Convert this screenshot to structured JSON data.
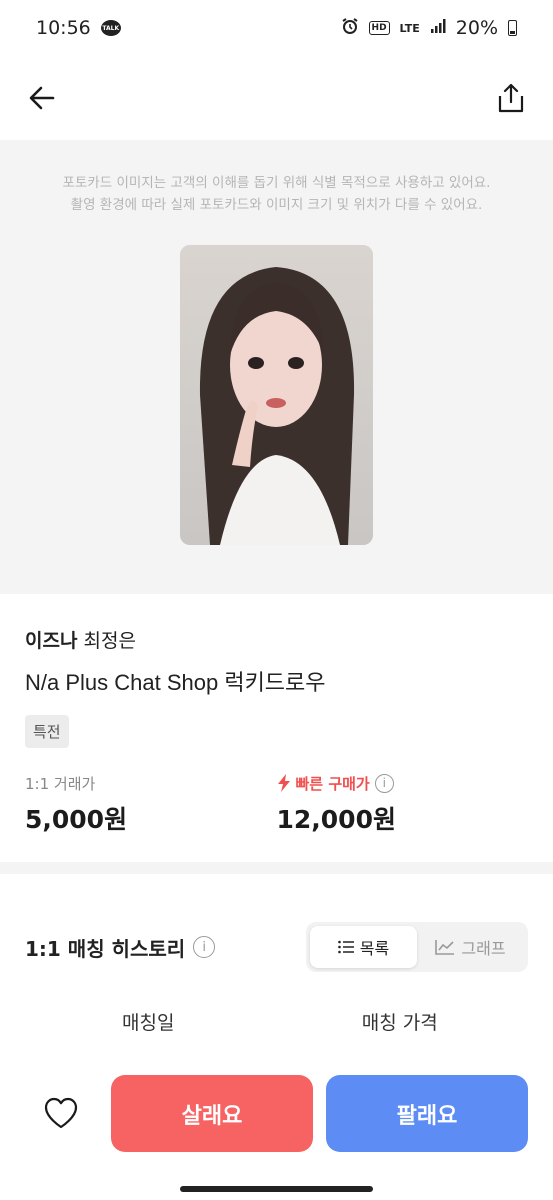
{
  "status_bar": {
    "time": "10:56",
    "talk_badge": "TALK",
    "hd": "HD",
    "network": "LTE",
    "battery": "20%"
  },
  "image_section": {
    "notice_line1": "포토카드 이미지는 고객의 이해를 돕기 위해 식별 목적으로 사용하고 있어요.",
    "notice_line2": "촬영 환경에 따라 실제 포토카드와 이미지 크기 및 위치가 다를 수 있어요."
  },
  "product": {
    "group": "이즈나",
    "member": "최정은",
    "title": "N/a Plus Chat Shop 럭키드로우",
    "tag": "특전"
  },
  "prices": {
    "trade_label": "1:1 거래가",
    "trade_value": "5,000원",
    "fast_label": "빠른 구매가",
    "fast_value": "12,000원"
  },
  "history": {
    "title": "1:1 매칭 히스토리",
    "toggle_list": "목록",
    "toggle_graph": "그래프",
    "col_date": "매칭일",
    "col_price": "매칭 가격"
  },
  "bottom": {
    "buy_label": "살래요",
    "sell_label": "팔래요"
  },
  "colors": {
    "buy": "#f66362",
    "sell": "#5e8cf5",
    "fast_price": "#f05050"
  }
}
